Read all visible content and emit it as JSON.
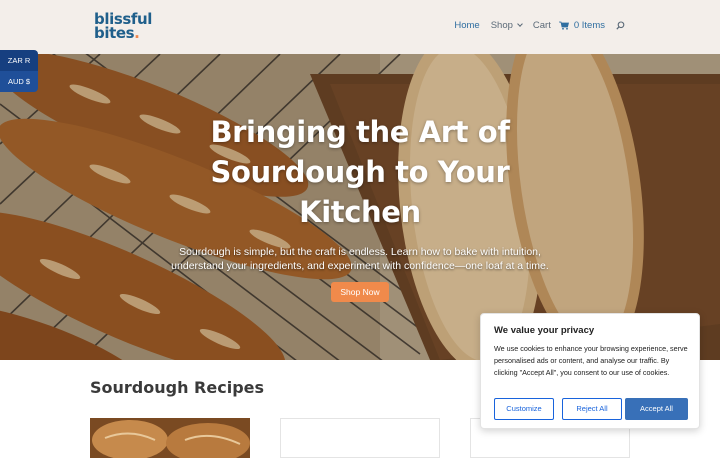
{
  "brand": {
    "line1": "blissful",
    "line2": "bites",
    "dot": ".",
    "primary_color": "#1f5f8b",
    "accent_color": "#f0884e"
  },
  "nav": {
    "home": "Home",
    "shop": "Shop",
    "cart": "Cart",
    "cart_count": "0 Items",
    "icons": {
      "shop": "chevron-down-icon",
      "cart": "cart-icon",
      "search": "search-icon"
    }
  },
  "currency": {
    "options": [
      "ZAR R",
      "AUD $"
    ]
  },
  "hero": {
    "title": "Bringing the Art of Sourdough to Your Kitchen",
    "subtitle": "Sourdough is simple, but the craft is endless. Learn how to bake with intuition, understand your ingredients, and experiment with confidence—one loaf at a time.",
    "button": "Shop Now",
    "button_color": "#f08a4b"
  },
  "recipes": {
    "title": "Sourdough Recipes"
  },
  "cookie": {
    "title": "We value your privacy",
    "text": "We use cookies to enhance your browsing experience, serve personalised ads or content, and analyse our traffic. By clicking \"Accept All\", you consent to our use of cookies.",
    "customize": "Customize",
    "reject": "Reject All",
    "accept": "Accept All",
    "accent_color": "#1863dc"
  }
}
